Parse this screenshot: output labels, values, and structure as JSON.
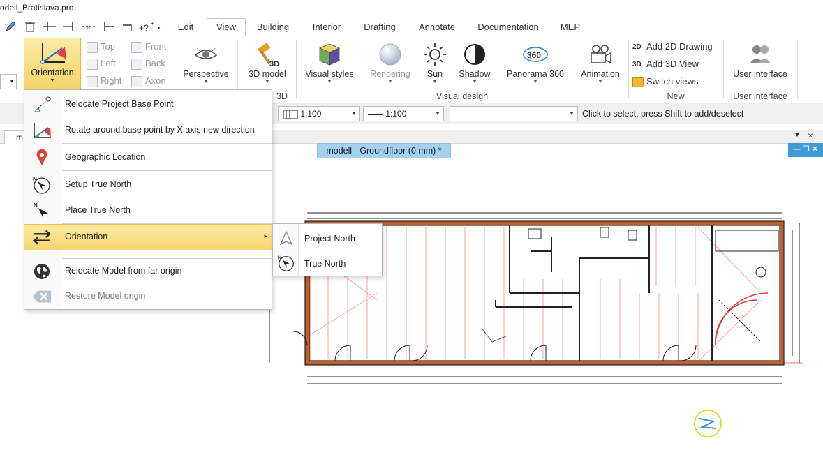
{
  "window": {
    "title": "odell_Bratislava.pro"
  },
  "tabs": [
    "Edit",
    "View",
    "Building",
    "Interior",
    "Drafting",
    "Annotate",
    "Documentation",
    "MEP"
  ],
  "active_tab": "View",
  "ribbon": {
    "orientation_label": "Orientation",
    "views": {
      "top": "Top",
      "left": "Left",
      "right": "Right",
      "front": "Front",
      "back": "Back",
      "axon": "Axon"
    },
    "perspective_label": "Perspective",
    "model3d_label": "3D model",
    "visual_styles_label": "Visual styles",
    "rendering_label": "Rendering",
    "sun_label": "Sun",
    "shadow_label": "Shadow",
    "panorama_label": "Panorama 360",
    "panorama_badge": "360",
    "animation_label": "Animation",
    "add_2d_label": "Add 2D Drawing",
    "add_3d_label": "Add 3D View",
    "switch_views_label": "Switch views",
    "badge_2d": "2D",
    "badge_3d": "3D",
    "model3d_badge": "3D",
    "user_interface_label": "User interface",
    "groups": {
      "partial_3d": "3D",
      "visual_design": "Visual design",
      "new": "New",
      "user_interface": "User interface"
    }
  },
  "options_bar": {
    "scale1": "1:100",
    "scale2": "1:100",
    "status": "Click to select, press Shift to add/deselect"
  },
  "document": {
    "tab_fragment": "m",
    "view_tab": "modell - Groundfloor (0 mm) *"
  },
  "menu": {
    "items": [
      {
        "label": "Relocate Project Base Point",
        "icon": "base-point-icon"
      },
      {
        "label": "Rotate around base point by X axis new direction",
        "icon": "rotate-axis-icon"
      },
      {
        "label": "Geographic Location",
        "icon": "location-pin-icon"
      },
      {
        "label": "Setup True North",
        "icon": "compass-icon"
      },
      {
        "label": "Place True North",
        "icon": "north-arrow-icon"
      },
      {
        "label": "Orientation",
        "icon": "swap-arrows-icon"
      },
      {
        "label": "Relocate Model from far origin",
        "icon": "globe-icon"
      },
      {
        "label": "Restore Model origin",
        "icon": "clear-icon"
      }
    ],
    "submenu": [
      {
        "label": "Project North",
        "icon": "triangle-north-icon"
      },
      {
        "label": "True North",
        "icon": "compass-icon"
      }
    ],
    "north_letter": "N"
  },
  "colors": {
    "highlight": "#f8d770",
    "view_tab": "#a7d0ee",
    "accent_blue": "#3d9bd9",
    "plan_red": "#e23b3b",
    "plan_brown": "#c0602a"
  }
}
